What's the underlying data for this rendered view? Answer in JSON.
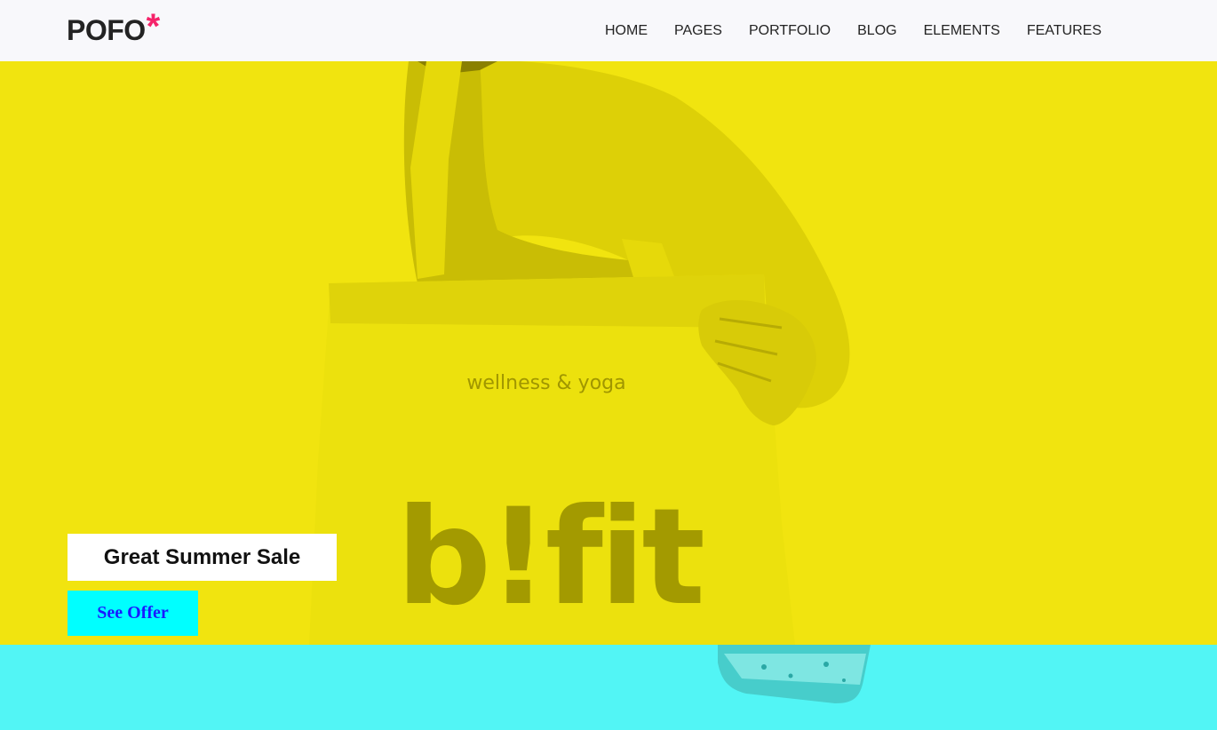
{
  "brand": {
    "name": "POFO",
    "mark": "*",
    "mark_color": "#f5236a"
  },
  "nav": {
    "items": [
      "HOME",
      "PAGES",
      "PORTFOLIO",
      "BLOG",
      "ELEMENTS",
      "FEATURES"
    ]
  },
  "hero": {
    "background_color": "#f1e40f",
    "image_alt": "Person holding a tote bag",
    "bag_tagline": "wellness & yoga",
    "bag_brand": "b!fit",
    "sale_label": "Great Summer Sale",
    "cta_label": "See Offer",
    "cta_color": "#00ffff"
  },
  "band": {
    "background_color": "#52f5f5"
  }
}
